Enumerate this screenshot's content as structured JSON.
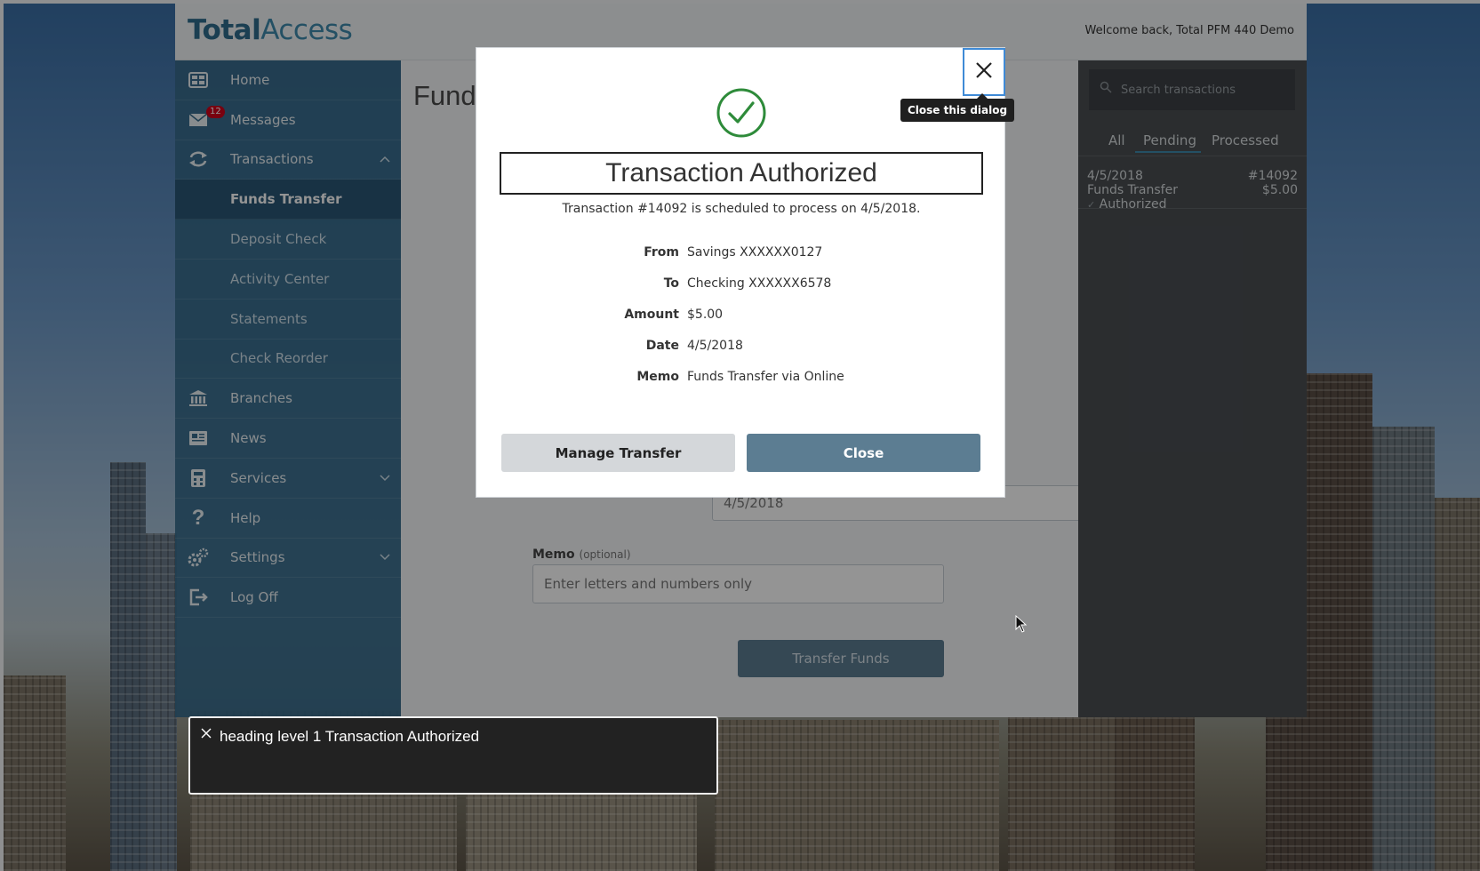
{
  "header": {
    "logo_part1": "Total",
    "logo_part2": "Access",
    "welcome": "Welcome back, Total PFM 440 Demo"
  },
  "sidebar": {
    "items": [
      {
        "label": "Home",
        "icon": "home-icon"
      },
      {
        "label": "Messages",
        "icon": "envelope-icon",
        "badge": "12"
      },
      {
        "label": "Transactions",
        "icon": "transfer-arrows-icon",
        "chevron": "up"
      },
      {
        "label": "Funds Transfer",
        "sub": true,
        "active": true
      },
      {
        "label": "Deposit Check",
        "sub": true
      },
      {
        "label": "Activity Center",
        "sub": true
      },
      {
        "label": "Statements",
        "sub": true
      },
      {
        "label": "Check Reorder",
        "sub": true
      },
      {
        "label": "Branches",
        "icon": "bank-icon"
      },
      {
        "label": "News",
        "icon": "newspaper-icon"
      },
      {
        "label": "Services",
        "icon": "calculator-icon",
        "chevron": "down"
      },
      {
        "label": "Help",
        "icon": "question-icon"
      },
      {
        "label": "Settings",
        "icon": "gears-icon",
        "chevron": "down"
      },
      {
        "label": "Log Off",
        "icon": "logout-icon"
      }
    ]
  },
  "main": {
    "page_title": "Funds",
    "date_value": "4/5/2018",
    "memo_label": "Memo",
    "memo_optional": "(optional)",
    "memo_placeholder": "Enter letters and numbers only",
    "transfer_button": "Transfer Funds"
  },
  "right_panel": {
    "search_placeholder": "Search transactions",
    "tabs": [
      "All",
      "Pending",
      "Processed"
    ],
    "selected_tab": "Pending",
    "transaction": {
      "date": "4/5/2018",
      "number": "#14092",
      "description": "Funds Transfer",
      "amount": "$5.00",
      "status": "Authorized"
    }
  },
  "modal": {
    "close_tooltip": "Close this dialog",
    "title": "Transaction Authorized",
    "subtitle": "Transaction #14092 is scheduled to process on 4/5/2018.",
    "details": [
      {
        "label": "From",
        "value": "Savings XXXXXX0127"
      },
      {
        "label": "To",
        "value": "Checking XXXXXX6578"
      },
      {
        "label": "Amount",
        "value": "$5.00"
      },
      {
        "label": "Date",
        "value": "4/5/2018"
      },
      {
        "label": "Memo",
        "value": "Funds Transfer via Online"
      }
    ],
    "manage_button": "Manage Transfer",
    "close_button": "Close"
  },
  "screen_reader": {
    "text": "heading level 1 Transaction Authorized"
  },
  "colors": {
    "accent": "#3e8bad",
    "sidebar_bg": "#386c8c",
    "button_primary": "#5c7d92",
    "success_green": "#2e8b3a"
  }
}
